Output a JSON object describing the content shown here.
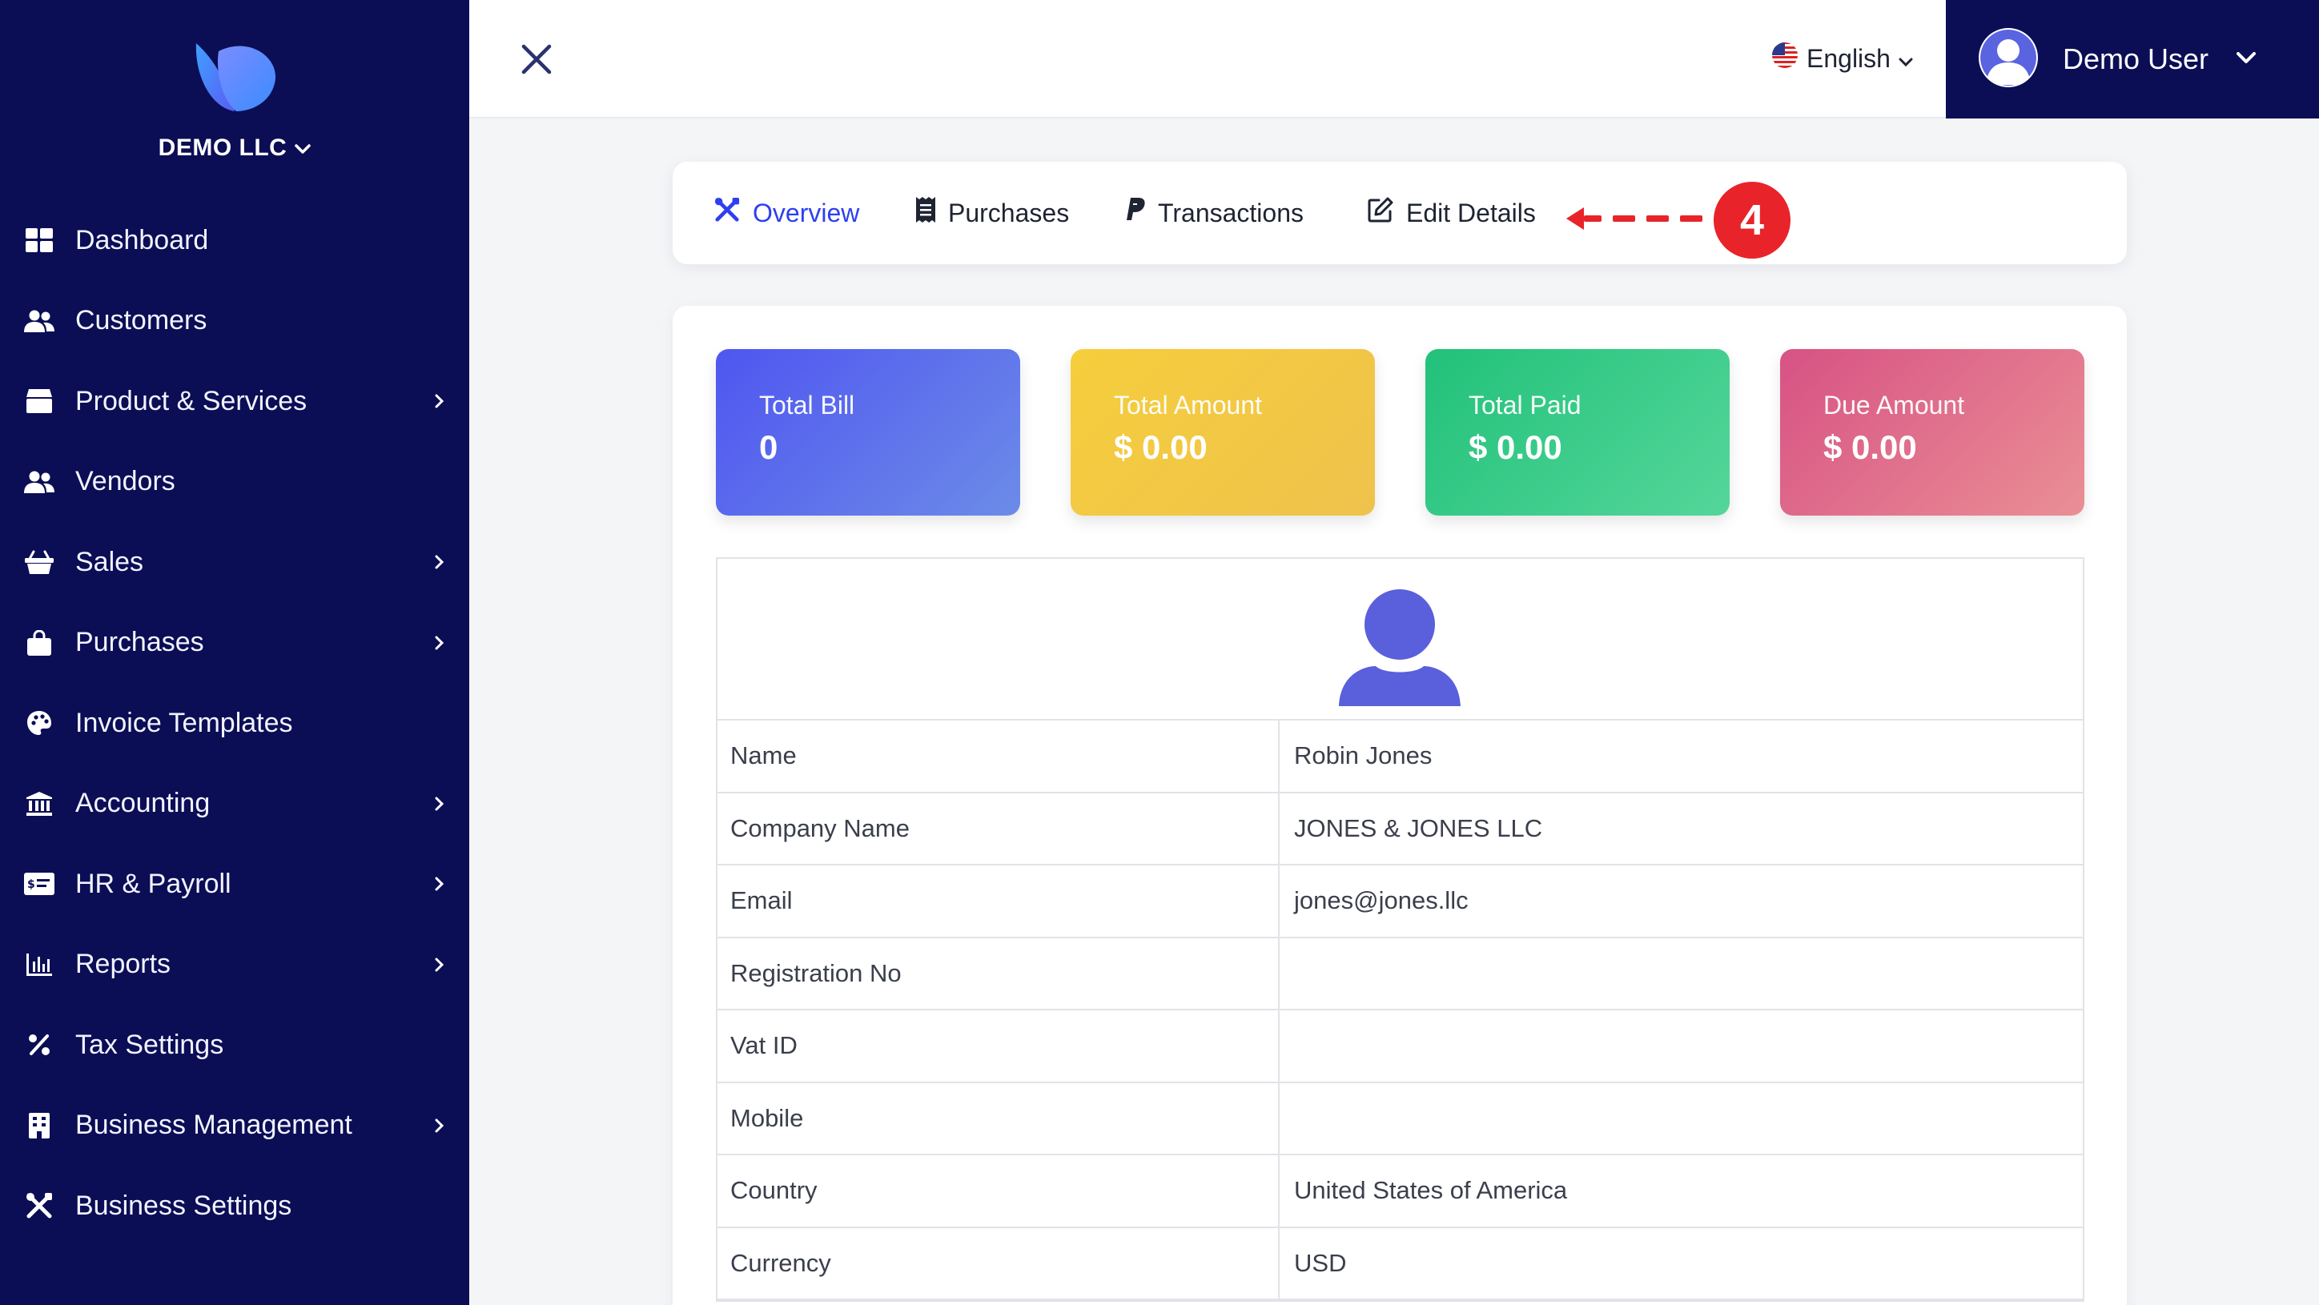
{
  "brand": {
    "company": "DEMO LLC"
  },
  "sidebar": {
    "items": [
      {
        "label": "Dashboard",
        "icon": "dashboard-icon",
        "has_submenu": false
      },
      {
        "label": "Customers",
        "icon": "users-icon",
        "has_submenu": false
      },
      {
        "label": "Product & Services",
        "icon": "box-icon",
        "has_submenu": true
      },
      {
        "label": "Vendors",
        "icon": "users-icon",
        "has_submenu": false
      },
      {
        "label": "Sales",
        "icon": "basket-icon",
        "has_submenu": true
      },
      {
        "label": "Purchases",
        "icon": "bag-icon",
        "has_submenu": true
      },
      {
        "label": "Invoice Templates",
        "icon": "palette-icon",
        "has_submenu": false
      },
      {
        "label": "Accounting",
        "icon": "bank-icon",
        "has_submenu": true
      },
      {
        "label": "HR & Payroll",
        "icon": "id-card-icon",
        "has_submenu": true
      },
      {
        "label": "Reports",
        "icon": "bar-chart-icon",
        "has_submenu": true
      },
      {
        "label": "Tax Settings",
        "icon": "percent-icon",
        "has_submenu": false
      },
      {
        "label": "Business Management",
        "icon": "building-icon",
        "has_submenu": true
      },
      {
        "label": "Business Settings",
        "icon": "tools-icon",
        "has_submenu": false
      }
    ]
  },
  "topbar": {
    "language": "English",
    "user_name": "Demo User"
  },
  "tabs": [
    {
      "label": "Overview",
      "active": true
    },
    {
      "label": "Purchases",
      "active": false
    },
    {
      "label": "Transactions",
      "active": false
    },
    {
      "label": "Edit Details",
      "active": false
    }
  ],
  "annotation": {
    "step": "4"
  },
  "stats": [
    {
      "label": "Total Bill",
      "value": "0"
    },
    {
      "label": "Total Amount",
      "value": "$ 0.00"
    },
    {
      "label": "Total Paid",
      "value": "$ 0.00"
    },
    {
      "label": "Due Amount",
      "value": "$ 0.00"
    }
  ],
  "details": [
    {
      "key": "Name",
      "value": "Robin Jones"
    },
    {
      "key": "Company Name",
      "value": "JONES & JONES LLC"
    },
    {
      "key": "Email",
      "value": "jones@jones.llc"
    },
    {
      "key": "Registration No",
      "value": ""
    },
    {
      "key": "Vat ID",
      "value": ""
    },
    {
      "key": "Mobile",
      "value": ""
    },
    {
      "key": "Country",
      "value": "United States of America"
    },
    {
      "key": "Currency",
      "value": "USD"
    }
  ],
  "colors": {
    "sidebar_bg": "#0b0e55",
    "accent": "#2d3ff0",
    "annotation_red": "#e8242a"
  }
}
